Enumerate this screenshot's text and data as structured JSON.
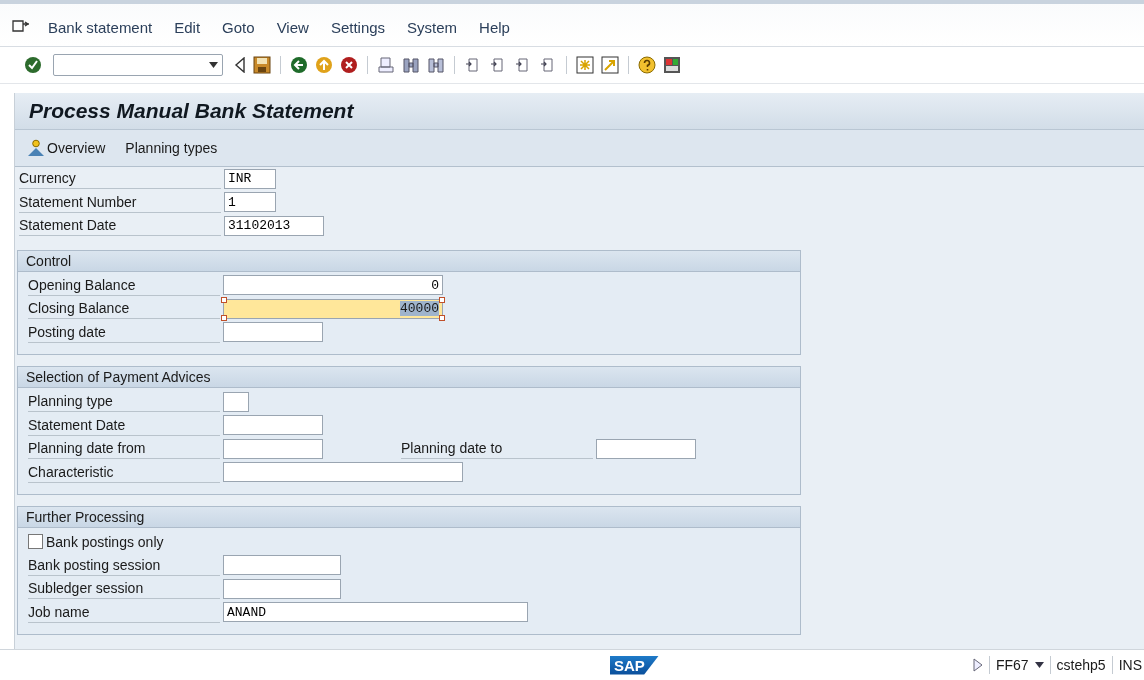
{
  "menu": [
    "Bank statement",
    "Edit",
    "Goto",
    "View",
    "Settings",
    "System",
    "Help"
  ],
  "title": "Process Manual Bank Statement",
  "app_toolbar": [
    {
      "label": "Overview",
      "kind": "icon_button"
    },
    {
      "label": "Planning types",
      "kind": "text_button"
    }
  ],
  "header_fields": [
    {
      "label": "Currency",
      "value": "INR",
      "kind": "code",
      "focused": false
    },
    {
      "label": "Statement Number",
      "value": "1",
      "kind": "code",
      "focused": false
    },
    {
      "label": "Statement Date",
      "value": "31102013",
      "kind": "date",
      "focused": false
    }
  ],
  "groups": [
    {
      "title": "Control",
      "rows": [
        {
          "kind": "amount",
          "label": "Opening Balance",
          "value": "0",
          "focused": false
        },
        {
          "kind": "amount",
          "label": "Closing Balance",
          "value": "40000",
          "focused": true
        },
        {
          "kind": "date",
          "label": "Posting date",
          "focused": false
        }
      ]
    },
    {
      "title": "Selection of Payment Advices",
      "rows": [
        {
          "kind": "flag",
          "label": "Planning type",
          "focused": false
        },
        {
          "kind": "date",
          "label": "Statement Date",
          "focused": false
        },
        {
          "kind": "date",
          "label": "Planning date from",
          "focused": false,
          "extra": {
            "label": "Planning date to"
          }
        },
        {
          "kind": "text",
          "label": "Characteristic",
          "focused": false
        }
      ]
    },
    {
      "title": "Further Processing",
      "rows": [
        {
          "kind": "checkbox",
          "label": "Bank postings only",
          "checked": false
        },
        {
          "kind": "session",
          "label": "Bank posting session",
          "focused": false
        },
        {
          "kind": "session",
          "label": "Subledger session",
          "focused": false
        },
        {
          "kind": "job",
          "label": "Job name",
          "value": "ANAND",
          "focused": false
        }
      ]
    }
  ],
  "status_bar": {
    "logo": "SAP",
    "transaction": "FF67",
    "system": "cstehp5",
    "mode": "INS"
  }
}
